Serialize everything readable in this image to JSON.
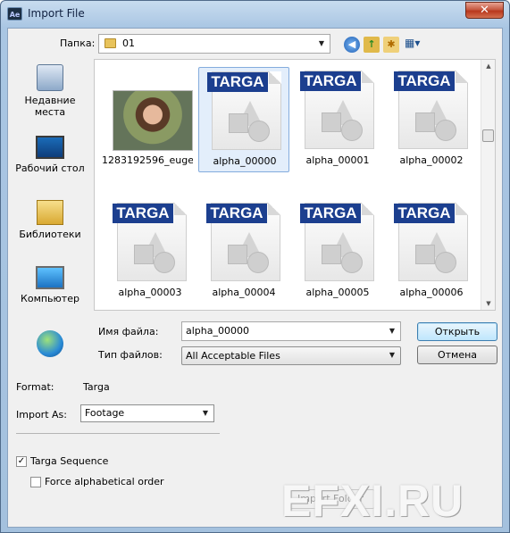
{
  "window": {
    "app_icon": "Ae",
    "title": "Import File",
    "close_glyph": "✕"
  },
  "toolbar": {
    "folder_label": "Папка:",
    "folder_value": "01",
    "icons": [
      "folder-icon",
      "back-icon",
      "up-folder-icon",
      "new-folder-icon",
      "view-menu-icon"
    ]
  },
  "places": [
    {
      "label": "Недавние места",
      "icon": "recent-places-icon"
    },
    {
      "label": "Рабочий стол",
      "icon": "desktop-icon"
    },
    {
      "label": "Библиотеки",
      "icon": "libraries-icon"
    },
    {
      "label": "Компьютер",
      "icon": "computer-icon"
    },
    {
      "label": "",
      "icon": "network-icon"
    }
  ],
  "files": [
    {
      "name": "1283192596_euge...",
      "kind": "photo"
    },
    {
      "name": "alpha_00000",
      "kind": "targa",
      "selected": true
    },
    {
      "name": "alpha_00001",
      "kind": "targa"
    },
    {
      "name": "alpha_00002",
      "kind": "targa"
    },
    {
      "name": "alpha_00003",
      "kind": "targa"
    },
    {
      "name": "alpha_00004",
      "kind": "targa"
    },
    {
      "name": "alpha_00005",
      "kind": "targa"
    },
    {
      "name": "alpha_00006",
      "kind": "targa"
    }
  ],
  "targa_badge": "TARGA",
  "form": {
    "filename_label": "Имя файла:",
    "filename_value": "alpha_00000",
    "filetype_label": "Тип файлов:",
    "filetype_value": "All Acceptable Files",
    "open_button": "Открыть",
    "cancel_button": "Отмена"
  },
  "options": {
    "format_label": "Format:",
    "format_value": "Targa",
    "import_as_label": "Import As:",
    "import_as_value": "Footage",
    "targa_sequence_label": "Targa Sequence",
    "targa_sequence_checked": true,
    "force_alpha_label": "Force alphabetical order",
    "force_alpha_checked": false,
    "import_folder_button": "Import Folder"
  },
  "watermark": "EFXI.RU",
  "colors": {
    "title_accent": "#1c3f8f",
    "selection": "#e3eefb",
    "close_red": "#c75a42"
  }
}
